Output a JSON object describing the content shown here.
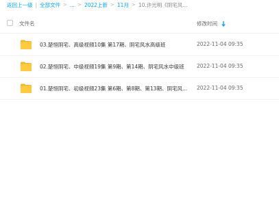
{
  "breadcrumb": {
    "back": "返回上一级",
    "divider": "|",
    "all_files": "全部文件",
    "arrow": ">",
    "ellipsis": "...",
    "level_2022": "2022上新",
    "level_month": "11月",
    "current": "10.许光明《阴宅风..."
  },
  "header": {
    "name_col": "文件名",
    "time_col": "修改时间",
    "sort_icon": "sort-down-icon"
  },
  "files": [
    {
      "name": "03.楚恒阴宅、高级视频10集 第17期、阴宅风水高级班",
      "modified": "2022-11-04 09:35",
      "icon": "folder-icon"
    },
    {
      "name": "02.楚恒阴宅、中级视频19集 第9期、第14期、阴宅风水中级班",
      "modified": "2022-11-04 09:35",
      "icon": "folder-icon"
    },
    {
      "name": "01.楚恒阴宅、初级视频23集 第6期、第8期、第13期、阴宅风...",
      "modified": "2022-11-04 09:35",
      "icon": "folder-icon"
    }
  ],
  "colors": {
    "link": "#06a7ff",
    "folder": "#ffc940",
    "folder_tab": "#f5b52f"
  }
}
